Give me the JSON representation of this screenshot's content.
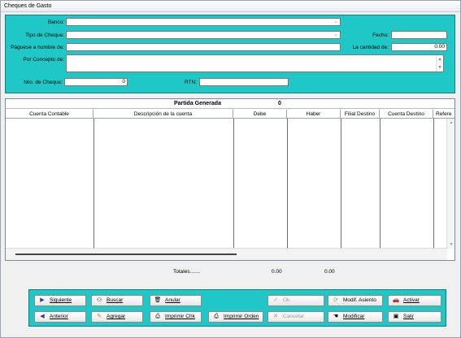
{
  "window": {
    "title": "Cheques de Gasto"
  },
  "form": {
    "banco_label": "Banco:",
    "banco_value": "",
    "tipo_label": "Tipo de Cheque:",
    "tipo_value": "",
    "pagese_label": "Páguese a nombre de:",
    "pagese_value": "",
    "concepto_label": "Por Concepto de:",
    "cheque_label": "Nro. de Cheque:",
    "cheque_value": "0",
    "rtn_label": "RTN:",
    "rtn_value": "",
    "fecha_label": "Fecha:",
    "fecha_value": "",
    "cantidad_label": "La cantidad de:",
    "cantidad_value": "0.00"
  },
  "grid": {
    "title": "Partida Generada",
    "count": "0",
    "columns": [
      "Cuenta Contable",
      "Descripción de la cuenta",
      "Debe",
      "Haber",
      "Filial Destino",
      "Cuenta Destino",
      "Refere"
    ]
  },
  "totals": {
    "label": "Totales.......",
    "debe": "0.00",
    "haber": "0.00"
  },
  "buttons": {
    "siguiente": "Siguiente",
    "buscar": "Buscar",
    "anular": "Anular",
    "ok": "Ok",
    "modif_asiento": "Modif. Asiento",
    "activar": "Activar",
    "anterior": "Anterior",
    "agregar": "Agregar",
    "imprimir_chk": "Imprimir Chk",
    "imprimir_orden": "Imprimir Orden",
    "cancelar": "Cancelar",
    "modificar": "Modificar",
    "salir": "Salir"
  },
  "icons": {
    "siguiente": "play-right-icon",
    "anterior": "play-left-icon",
    "buscar": "binoculars-icon",
    "agregar": "pencil-icon",
    "anular": "trash-icon",
    "imprimir": "printer-icon",
    "ok": "checkmark-icon",
    "cancelar": "x-icon",
    "modif_asiento": "cycle-icon",
    "modificar": "edit-hand-icon",
    "activar": "car-icon",
    "salir": "book-exit-icon"
  },
  "colors": {
    "panel": "#20c7c7"
  }
}
